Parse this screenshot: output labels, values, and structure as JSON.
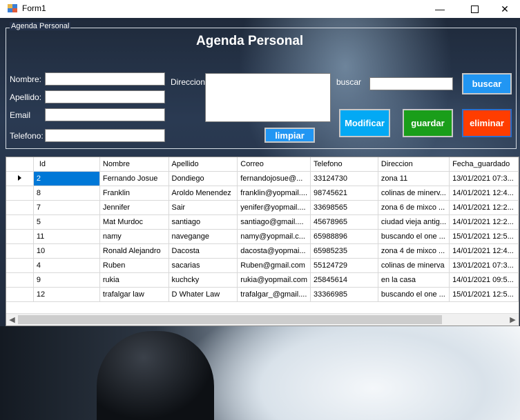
{
  "window": {
    "title": "Form1",
    "minimize": "—",
    "close": "✕"
  },
  "group": {
    "caption": "Agenda Personal"
  },
  "form": {
    "heading": "Agenda Personal",
    "nombre_label": "Nombre:",
    "apellido_label": "Apellido:",
    "email_label": "Email",
    "telefono_label": "Telefono:",
    "direccion_label": "Direccion",
    "buscar_label": "buscar",
    "buttons": {
      "buscar": "buscar",
      "limpiar": "limpiar",
      "modificar": "Modificar",
      "guardar": "guardar",
      "eliminar": "eliminar"
    },
    "colors": {
      "buscar": "#2196f3",
      "limpiar": "#2196f3",
      "modificar": "#03a9f4",
      "guardar": "#1a9e1a",
      "eliminar": "#ff3d00"
    }
  },
  "grid": {
    "columns": [
      "Id",
      "Nombre",
      "Apellido",
      "Correo",
      "Telefono",
      "Direccion",
      "Fecha_guardado"
    ],
    "rows": [
      [
        "2",
        "Fernando Josue",
        "Dondiego",
        "fernandojosue@...",
        "33124730",
        "zona 11",
        "13/01/2021 07:3..."
      ],
      [
        "8",
        "Franklin",
        "Aroldo Menendez",
        "franklin@yopmail....",
        "98745621",
        "colinas de minerv...",
        "14/01/2021 12:4..."
      ],
      [
        "7",
        "Jennifer",
        "Sair",
        "yenifer@yopmail....",
        "33698565",
        "zona 6 de mixco ...",
        "14/01/2021 12:2..."
      ],
      [
        "5",
        "Mat Murdoc",
        "santiago",
        "santiago@gmail....",
        "45678965",
        "ciudad vieja antig...",
        "14/01/2021 12:2..."
      ],
      [
        "11",
        "namy",
        "navegange",
        "namy@yopmail.c...",
        "65988896",
        "buscando el one ...",
        "15/01/2021 12:5..."
      ],
      [
        "10",
        "Ronald Alejandro",
        "Dacosta",
        "dacosta@yopmai...",
        "65985235",
        "zona 4 de mixco ...",
        "14/01/2021 12:4..."
      ],
      [
        "4",
        "Ruben",
        "sacarias",
        "Ruben@gmail.com",
        "55124729",
        "colinas de minerva",
        "13/01/2021 07:3..."
      ],
      [
        "9",
        "rukia",
        "kuchcky",
        "rukia@yopmail.com",
        "25845614",
        "en la casa",
        "14/01/2021 09:5..."
      ],
      [
        "12",
        "trafalgar law",
        "D Whater Law",
        "trafalgar_@gmail....",
        "33366985",
        "buscando el one ...",
        "15/01/2021 12:5..."
      ]
    ]
  }
}
